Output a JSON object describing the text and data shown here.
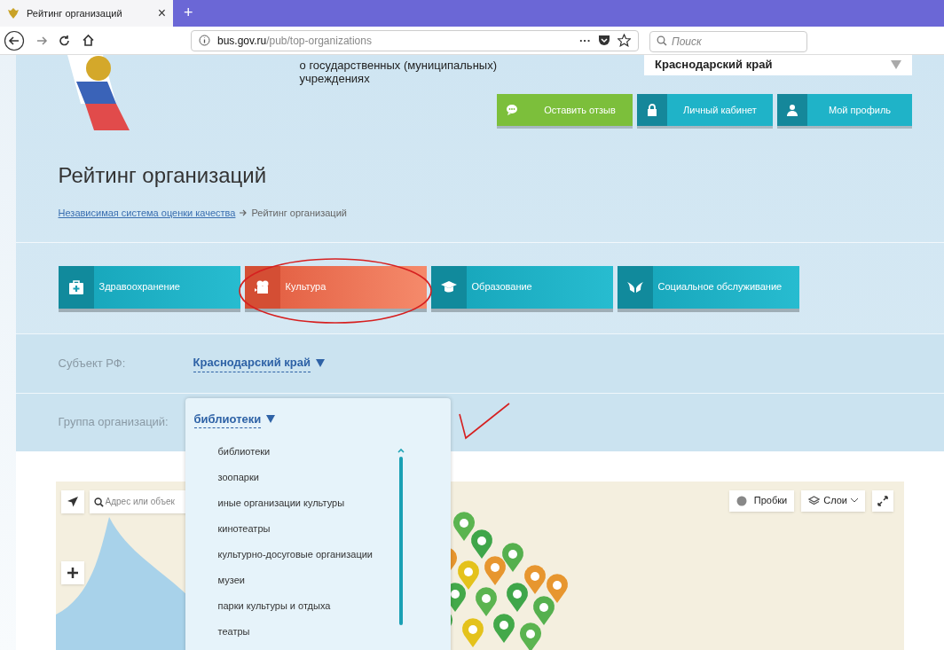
{
  "browser": {
    "tab_title": "Рейтинг организаций",
    "tab_close": "×",
    "new_tab": "+",
    "url_domain": "bus.gov.ru",
    "url_path": "/pub/top-organizations",
    "page_actions": "···",
    "search_placeholder": "Поиск"
  },
  "header": {
    "agency_lines": [
      "о государственных (муниципальных)",
      "учреждениях"
    ],
    "region": "Краснодарский край",
    "buttons": [
      {
        "label": "Оставить отзыв",
        "kind": "feedback"
      },
      {
        "label": "Личный кабинет",
        "kind": "cabinet"
      },
      {
        "label": "Мой профиль",
        "kind": "profile"
      }
    ]
  },
  "title": "Рейтинг организаций",
  "breadcrumb": [
    {
      "label": "Независимая система оценки качества",
      "kind": "link"
    },
    {
      "label": "Рейтинг организаций",
      "kind": "current"
    }
  ],
  "categories": [
    {
      "label": "Здравоохранение",
      "kind": "health",
      "selected": false
    },
    {
      "label": "Культура",
      "kind": "culture",
      "selected": true
    },
    {
      "label": "Образование",
      "kind": "education",
      "selected": false
    },
    {
      "label": "Социальное обслуживание",
      "kind": "social",
      "selected": false
    }
  ],
  "filters": [
    {
      "label": "Субъект РФ:",
      "value": "Краснодарский край",
      "expanded": false
    },
    {
      "label": "Группа организаций:",
      "value": "библиотеки",
      "expanded": true,
      "options": [
        "библиотеки",
        "зоопарки",
        "иные организации культуры",
        "кинотеатры",
        "культурно-досуговые организации",
        "музеи",
        "парки культуры и отдыха",
        "театры"
      ]
    }
  ],
  "map": {
    "search_placeholder": "Адрес или объек",
    "traffic": "Пробки",
    "layers": "Слои"
  },
  "annotations": [
    {
      "kind": "ellipse"
    },
    {
      "kind": "checkmark"
    }
  ]
}
